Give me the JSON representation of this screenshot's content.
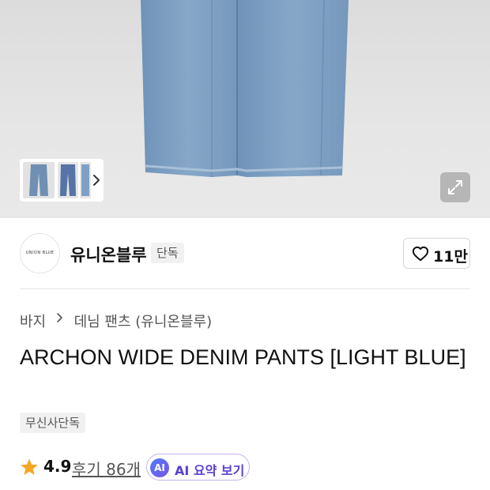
{
  "gallery": {
    "expand_icon": "expand-icon",
    "next_icon": "chevron-right-icon"
  },
  "brand": {
    "logo_text": "UNION BLUE",
    "name": "유니온블루",
    "tag": "단독"
  },
  "like": {
    "icon": "heart-icon",
    "count": "11만"
  },
  "breadcrumb": {
    "items": [
      "바지",
      "데님 팬츠 (유니온블루)"
    ],
    "separator_icon": "chevron-right-icon"
  },
  "product": {
    "title": "ARCHON WIDE DENIM PANTS [LIGHT BLUE]",
    "badge": "무신사단독"
  },
  "rating": {
    "star_icon": "star-icon",
    "star_color": "#f5a623",
    "score": "4.9",
    "reviews": "후기 86개"
  },
  "ai_summary": {
    "badge": "AI",
    "label": "AI 요약 보기",
    "accent": "#5b3fd1"
  }
}
